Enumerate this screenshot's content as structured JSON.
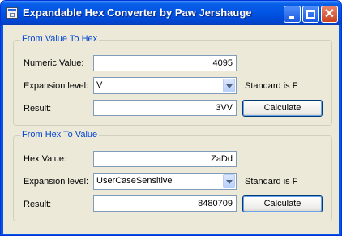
{
  "window": {
    "title": "Expandable Hex Converter by Paw Jershauge"
  },
  "value_to_hex": {
    "legend": "From Value To Hex",
    "numeric_label": "Numeric Value:",
    "numeric_value": "4095",
    "expansion_label": "Expansion level:",
    "expansion_value": "V",
    "expansion_hint": "Standard is F",
    "result_label": "Result:",
    "result_value": "3VV",
    "calculate_label": "Calculate"
  },
  "hex_to_value": {
    "legend": "From Hex To Value",
    "hex_label": "Hex Value:",
    "hex_value": "ZaDd",
    "expansion_label": "Expansion level:",
    "expansion_value": "UserCaseSensitive",
    "expansion_hint": "Standard is F",
    "result_label": "Result:",
    "result_value": "8480709",
    "calculate_label": "Calculate"
  },
  "colors": {
    "titlebar": "#0054e3",
    "client": "#ece9d8",
    "legend": "#0046d5",
    "close_button": "#c94320"
  },
  "icons": {
    "app": "form-icon",
    "minimize": "minimize-icon",
    "maximize": "maximize-icon",
    "close": "close-icon"
  }
}
